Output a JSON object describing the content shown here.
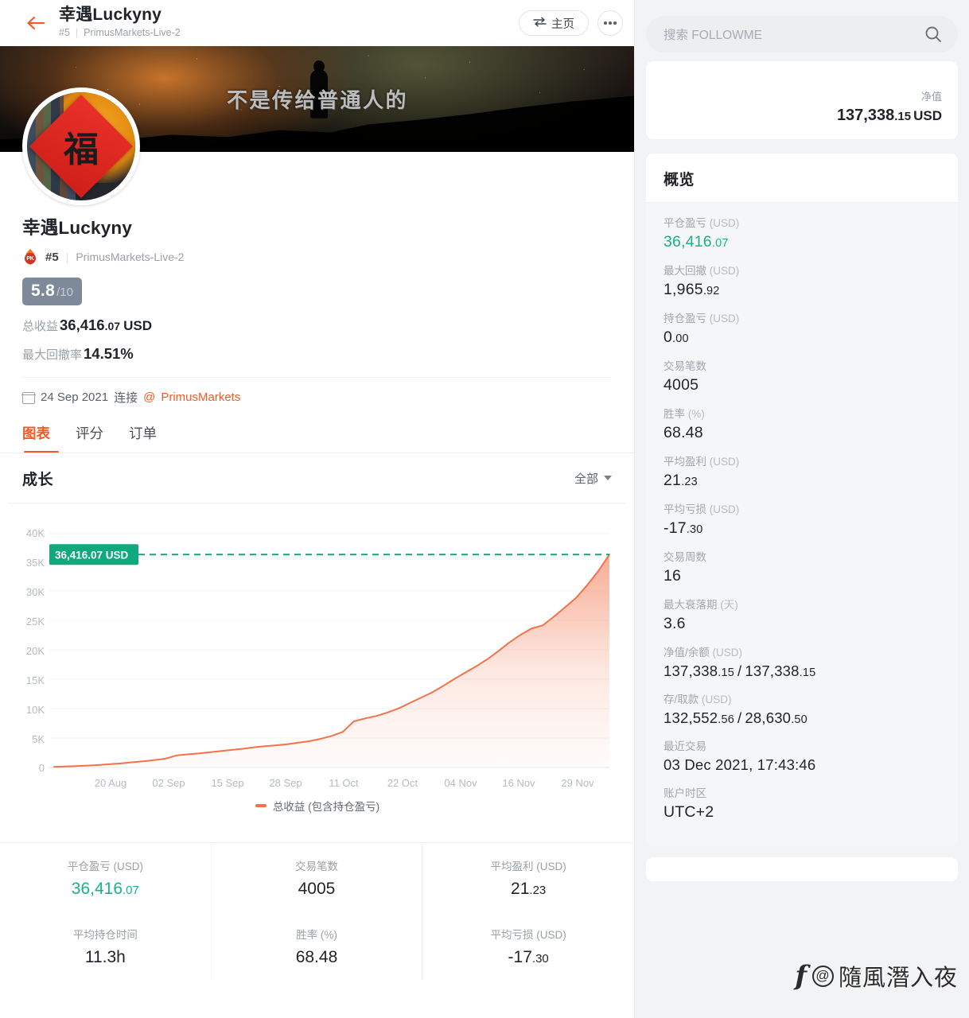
{
  "topbar": {
    "back_icon": "arrow-left-icon",
    "title": "幸遇Luckyny",
    "rank": "#5",
    "broker_account": "PrimusMarkets-Live-2",
    "home_button": "主页",
    "home_icon": "swap-icon",
    "more_icon": "ellipsis-icon"
  },
  "banner": {
    "caption": "不是传给普通人的",
    "avatar_glyph": "福"
  },
  "profile": {
    "name": "幸遇Luckyny",
    "badge_icon": "flame-pk-icon",
    "rank": "#5",
    "broker_account": "PrimusMarkets-Live-2",
    "score": "5.8",
    "score_max": "/10",
    "total_return_label": "总收益",
    "total_return_value": "36,416",
    "total_return_dec": ".07",
    "total_return_currency": "USD",
    "max_drawdown_label": "最大回撤率",
    "max_drawdown_value": "14.51%",
    "calendar_icon": "calendar-icon",
    "connect_date": "24 Sep 2021",
    "connect_word": "连接",
    "connect_at": "@",
    "connect_broker": "PrimusMarkets"
  },
  "tabs": [
    {
      "label": "图表",
      "active": true
    },
    {
      "label": "评分",
      "active": false
    },
    {
      "label": "订单",
      "active": false
    }
  ],
  "growth": {
    "title": "成长",
    "range_label": "全部",
    "range_caret": "chevron-down-icon",
    "marker_label": "36,416.07 USD"
  },
  "chart_data": {
    "type": "area",
    "title": "成长",
    "xlabel": "",
    "ylabel": "",
    "ylim": [
      0,
      40000
    ],
    "grid": true,
    "legend_position": "bottom",
    "legend": [
      "总收益 (包含持仓盈亏)"
    ],
    "annotation": {
      "label": "36,416.07 USD",
      "value": 36416.07,
      "style": "dashed-teal-line"
    },
    "y_ticks": [
      "0",
      "5K",
      "10K",
      "15K",
      "20K",
      "25K",
      "30K",
      "35K",
      "40K"
    ],
    "y_tick_values": [
      0,
      5000,
      10000,
      15000,
      20000,
      25000,
      30000,
      35000,
      40000
    ],
    "x_ticks": [
      "20 Aug",
      "02 Sep",
      "15 Sep",
      "28 Sep",
      "11 Oct",
      "22 Oct",
      "04 Nov",
      "16 Nov",
      "29 Nov"
    ],
    "series": [
      {
        "name": "总收益 (包含持仓盈亏)",
        "color": "#f4724a",
        "x": [
          0,
          2,
          4,
          6,
          8,
          10,
          12,
          14,
          16,
          18,
          20,
          22,
          24,
          26,
          28,
          30,
          32,
          34,
          36,
          38,
          40,
          42,
          44,
          46,
          48,
          50,
          52,
          54,
          56,
          58,
          60,
          62,
          64,
          66,
          68,
          70,
          72,
          74,
          76,
          78,
          80,
          82,
          84,
          86,
          88,
          90,
          92,
          94,
          96,
          98,
          100
        ],
        "values": [
          120,
          180,
          240,
          320,
          420,
          560,
          700,
          880,
          1050,
          1250,
          1500,
          2050,
          2250,
          2400,
          2600,
          2800,
          3000,
          3200,
          3450,
          3650,
          3800,
          3980,
          4250,
          4500,
          4900,
          5400,
          6100,
          7900,
          8400,
          8800,
          9400,
          10100,
          11000,
          11900,
          12800,
          13900,
          15100,
          16200,
          17300,
          18500,
          19900,
          21400,
          22700,
          23800,
          24300,
          25800,
          27400,
          29000,
          31200,
          33600,
          36416
        ]
      }
    ]
  },
  "bottom_stats": [
    {
      "label": "平仓盈亏 (USD)",
      "value": "36,416",
      "dec": ".07",
      "green": true
    },
    {
      "label": "交易笔数",
      "value": "4005",
      "dec": "",
      "green": false
    },
    {
      "label": "平均盈利 (USD)",
      "value": "21",
      "dec": ".23",
      "green": false
    },
    {
      "label": "平均持仓时间",
      "value": "11.3h",
      "dec": "",
      "green": false
    },
    {
      "label": "胜率 (%)",
      "value": "68.48",
      "dec": "",
      "green": false
    },
    {
      "label": "平均亏损 (USD)",
      "value": "-17",
      "dec": ".30",
      "green": false
    }
  ],
  "sidebar": {
    "search_placeholder": "搜索 FOLLOWME",
    "search_icon": "search-icon",
    "net_value_label": "净值",
    "net_value": "137,338",
    "net_value_dec": ".15",
    "net_value_currency": "USD",
    "overview_title": "概览",
    "overview_items": [
      {
        "label": "平仓盈亏",
        "unit": "(USD)",
        "value": "36,416",
        "dec": ".07",
        "green": true
      },
      {
        "label": "最大回撤",
        "unit": "(USD)",
        "value": "1,965",
        "dec": ".92",
        "green": false
      },
      {
        "label": "持仓盈亏",
        "unit": "(USD)",
        "value": "0",
        "dec": ".00",
        "green": false
      },
      {
        "label": "交易笔数",
        "unit": "",
        "value": "4005",
        "dec": "",
        "green": false
      },
      {
        "label": "胜率",
        "unit": "(%)",
        "value": "68.48",
        "dec": "",
        "green": false
      },
      {
        "label": "平均盈利",
        "unit": "(USD)",
        "value": "21",
        "dec": ".23",
        "green": false
      },
      {
        "label": "平均亏损",
        "unit": "(USD)",
        "value": "-17",
        "dec": ".30",
        "green": false
      },
      {
        "label": "交易周数",
        "unit": "",
        "value": "16",
        "dec": "",
        "green": false
      },
      {
        "label": "最大衰落期",
        "unit": "(天)",
        "value": "3.6",
        "dec": "",
        "green": false
      },
      {
        "label": "净值/余额",
        "unit": "(USD)",
        "value": "137,338",
        "dec": ".15",
        "value2": "137,338",
        "dec2": ".15",
        "green": false
      },
      {
        "label": "存/取款",
        "unit": "(USD)",
        "value": "132,552",
        "dec": ".56",
        "value2": "28,630",
        "dec2": ".50",
        "green": false
      },
      {
        "label": "最近交易",
        "unit": "",
        "value": "03 Dec 2021, 17:43:46",
        "dec": "",
        "green": false
      },
      {
        "label": "账户时区",
        "unit": "",
        "value": "UTC+2",
        "dec": "",
        "green": false
      }
    ]
  },
  "watermark": {
    "logo": "f",
    "at": "@",
    "handle": "隨風潛入夜"
  },
  "colors": {
    "accent": "#f15a29",
    "chart_line": "#f4724a",
    "green": "#18b388",
    "teal_marker": "#11a87d",
    "score_badge": "#7e8a99"
  }
}
